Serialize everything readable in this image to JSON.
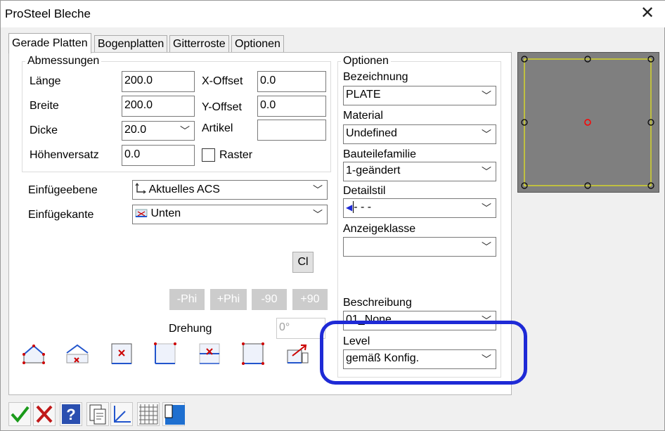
{
  "window": {
    "title": "ProSteel Bleche"
  },
  "tabs": [
    "Gerade Platten",
    "Bogenplatten",
    "Gitterroste",
    "Optionen"
  ],
  "abmessungen": {
    "title": "Abmessungen",
    "laenge_label": "Länge",
    "laenge_value": "200.0",
    "breite_label": "Breite",
    "breite_value": "200.0",
    "dicke_label": "Dicke",
    "dicke_value": "20.0",
    "hoehenversatz_label": "Höhenversatz",
    "hoehenversatz_value": "0.0",
    "xoffset_label": "X-Offset",
    "xoffset_value": "0.0",
    "yoffset_label": "Y-Offset",
    "yoffset_value": "0.0",
    "artikel_label": "Artikel",
    "artikel_value": "",
    "raster_label": "Raster"
  },
  "einfuege": {
    "ebene_label": "Einfügeebene",
    "ebene_value": "Aktuelles ACS",
    "kante_label": "Einfügekante",
    "kante_value": "Unten"
  },
  "rotation": {
    "cl_label": "Cl",
    "minus_phi": "-Phi",
    "plus_phi": "+Phi",
    "minus_90": "-90",
    "plus_90": "+90",
    "drehung_label": "Drehung",
    "drehung_value": "0°"
  },
  "optionen": {
    "title": "Optionen",
    "bezeichnung_label": "Bezeichnung",
    "bezeichnung_value": "PLATE",
    "material_label": "Material",
    "material_value": "Undefined",
    "familie_label": "Bauteilefamilie",
    "familie_value": "1-geändert",
    "detailstil_label": "Detailstil",
    "detailstil_value": "- - -",
    "anzeige_label": "Anzeigeklasse",
    "anzeige_value": "",
    "beschreibung_label": "Beschreibung",
    "beschreibung_value": "01_None",
    "level_label": "Level",
    "level_value": "gemäß Konfig."
  },
  "colors": {
    "highlight": "#1e2ad6",
    "preview_bg": "#7f7f7f",
    "preview_outline": "#ffff00",
    "center_point": "#ff0000"
  }
}
